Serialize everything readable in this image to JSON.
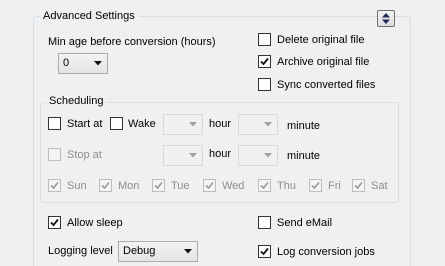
{
  "advanced": {
    "legend": "Advanced Settings",
    "collapse_icon": "collapse-expand-icon",
    "min_age_label": "Min age before conversion (hours)",
    "min_age_value": "0",
    "delete_original": "Delete original file",
    "archive_original": "Archive original file",
    "sync_converted": "Sync converted files",
    "allow_sleep": "Allow sleep",
    "send_email": "Send eMail",
    "logging_level_label": "Logging level",
    "logging_level_value": "Debug",
    "log_conversion_jobs": "Log conversion jobs"
  },
  "scheduling": {
    "legend": "Scheduling",
    "start_at": "Start at",
    "wake": "Wake",
    "stop_at": "Stop at",
    "hour": "hour",
    "minute": "minute",
    "days": [
      "Sun",
      "Mon",
      "Tue",
      "Wed",
      "Thu",
      "Fri",
      "Sat"
    ]
  },
  "colors": {
    "background": "#f0f0f0",
    "group_border": "#d5dfe5",
    "disabled_text": "#8d8d8d"
  }
}
